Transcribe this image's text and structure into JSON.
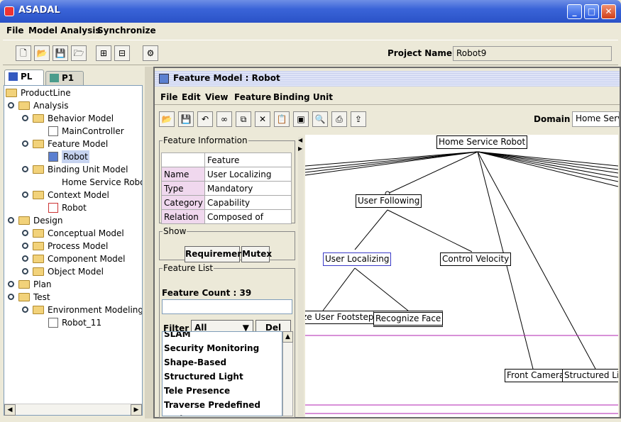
{
  "window": {
    "title": "ASADAL"
  },
  "menu": [
    "File",
    "Model Analysis",
    "Synchronize"
  ],
  "project": {
    "label": "Project Name :",
    "value": "Robot9"
  },
  "tabs": [
    "PL",
    "P1"
  ],
  "tree": [
    {
      "label": "ProductLine"
    },
    {
      "label": "Analysis"
    },
    {
      "label": "Behavior Model"
    },
    {
      "label": "MainController"
    },
    {
      "label": "Feature Model"
    },
    {
      "label": "Robot"
    },
    {
      "label": "Binding Unit Model"
    },
    {
      "label": "Home Service Robot"
    },
    {
      "label": "Context Model"
    },
    {
      "label": "Robot"
    },
    {
      "label": "Design"
    },
    {
      "label": "Conceptual Model"
    },
    {
      "label": "Process Model"
    },
    {
      "label": "Component Model"
    },
    {
      "label": "Object Model"
    },
    {
      "label": "Plan"
    },
    {
      "label": "Test"
    },
    {
      "label": "Environment Modeling"
    },
    {
      "label": "Robot_11"
    }
  ],
  "inner": {
    "title": "Feature Model : Robot",
    "menu": [
      "File",
      "Edit",
      "View",
      "Feature",
      "Binding Unit"
    ],
    "domain_label": "Domain :",
    "domain_value": "Home Servi"
  },
  "feature_info": {
    "legend": "Feature Information",
    "header": "Feature",
    "rows": [
      {
        "key": "Name",
        "value": "User Localizing"
      },
      {
        "key": "Type",
        "value": "Mandatory"
      },
      {
        "key": "Category",
        "value": "Capability"
      },
      {
        "key": "Relation",
        "value": "Composed of"
      }
    ]
  },
  "show": {
    "legend": "Show",
    "requirement": "Requirement",
    "mutex": "Mutex"
  },
  "feature_list": {
    "legend": "Feature List",
    "count": "Feature Count : 39",
    "filter_label": "Filter :",
    "filter_value": "All",
    "del": "Del",
    "items": [
      "SLAM",
      "Security Monitoring",
      "Shape-Based",
      "Structured Light",
      "Tele Presence",
      "Traverse Predefined Path"
    ]
  },
  "diagram": {
    "nodes": {
      "root": "Home Service Robot",
      "user_following": "User Following",
      "user_localizing": "User Localizing",
      "control_velocity": "Control Velocity",
      "footstep": "ze User Footstep",
      "recognize_face": "Recognize Face",
      "front_camera": "Front Camera",
      "structured_light": "Structured Lig"
    }
  }
}
